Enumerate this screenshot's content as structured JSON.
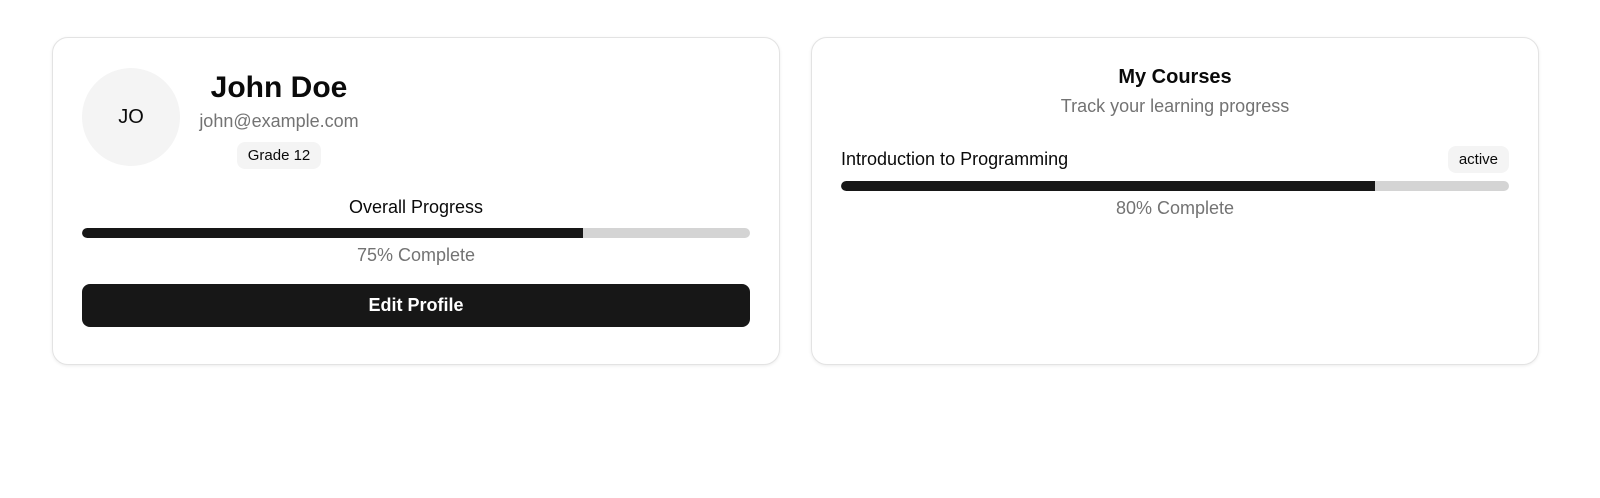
{
  "profile": {
    "avatar_initials": "JO",
    "name": "John Doe",
    "email": "john@example.com",
    "grade": "Grade 12",
    "progress_label": "Overall Progress",
    "progress_value": 75,
    "progress_text": "75% Complete",
    "edit_button_label": "Edit Profile"
  },
  "courses": {
    "title": "My Courses",
    "subtitle": "Track your learning progress",
    "items": [
      {
        "name": "Introduction to Programming",
        "status": "active",
        "progress_value": 80,
        "progress_text": "80% Complete"
      }
    ]
  },
  "colors": {
    "bar_fill": "#171717",
    "bar_track": "#d4d4d4",
    "muted_text": "#737373",
    "badge_bg": "#f4f4f4"
  }
}
